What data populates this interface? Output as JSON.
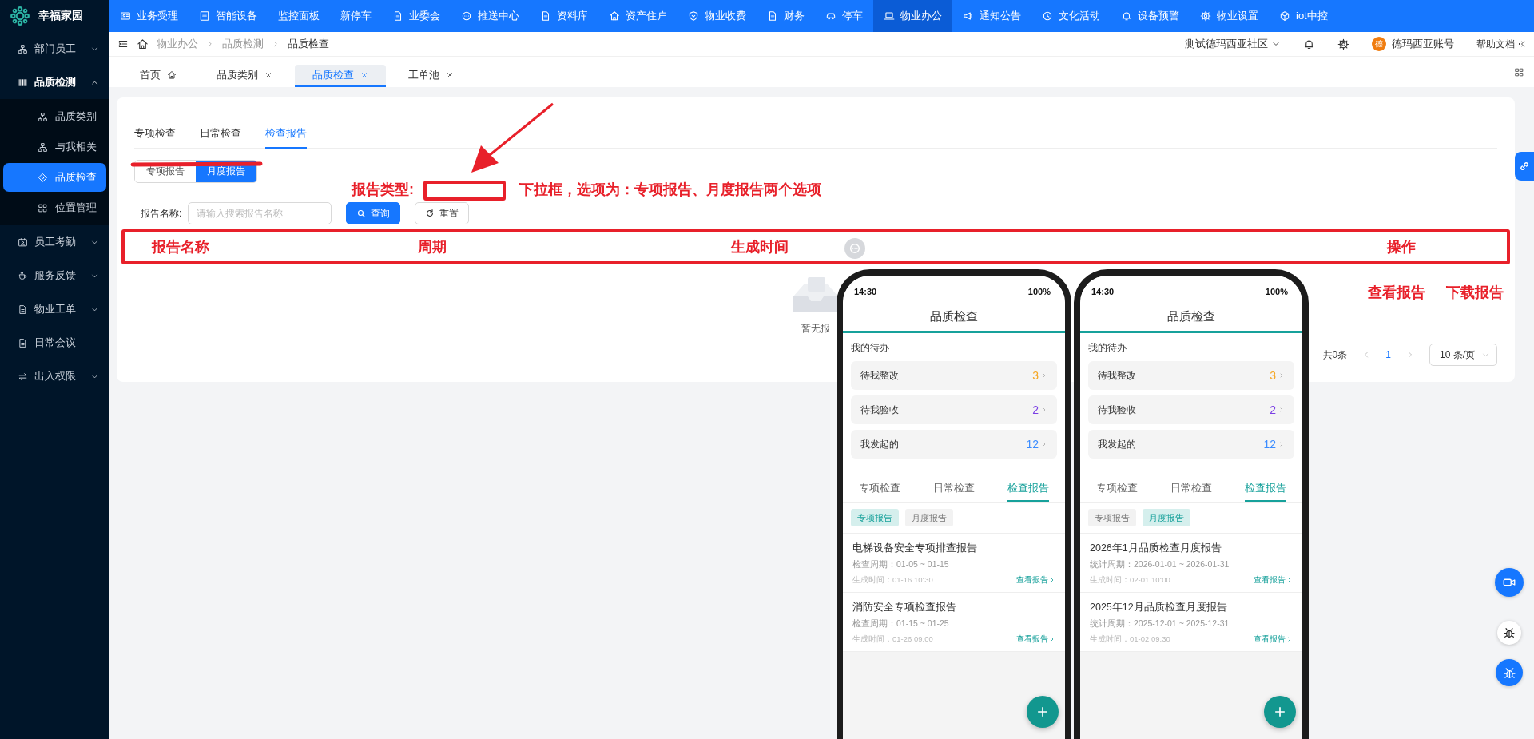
{
  "app": {
    "logo": "幸福家园"
  },
  "top_nav": [
    {
      "label": "业务受理",
      "selected": false
    },
    {
      "label": "智能设备",
      "selected": false
    },
    {
      "label": "监控面板",
      "selected": false
    },
    {
      "label": "新停车",
      "selected": false
    },
    {
      "label": "业委会",
      "selected": false
    },
    {
      "label": "推送中心",
      "selected": false
    },
    {
      "label": "资料库",
      "selected": false
    },
    {
      "label": "资产住户",
      "selected": false
    },
    {
      "label": "物业收费",
      "selected": false
    },
    {
      "label": "财务",
      "selected": false
    },
    {
      "label": "停车",
      "selected": false
    },
    {
      "label": "物业办公",
      "selected": true
    },
    {
      "label": "通知公告",
      "selected": false
    },
    {
      "label": "文化活动",
      "selected": false
    },
    {
      "label": "设备预警",
      "selected": false
    },
    {
      "label": "物业设置",
      "selected": false
    },
    {
      "label": "iot中控",
      "selected": false
    }
  ],
  "sidebar": [
    {
      "label": "部门员工",
      "kind": "group",
      "expanded": false
    },
    {
      "label": "品质检测",
      "kind": "group",
      "expanded": true,
      "children": [
        {
          "label": "品质类别",
          "selected": false
        },
        {
          "label": "与我相关",
          "selected": false
        },
        {
          "label": "品质检查",
          "selected": true
        },
        {
          "label": "位置管理",
          "selected": false
        }
      ]
    },
    {
      "label": "员工考勤",
      "kind": "group",
      "expanded": false
    },
    {
      "label": "服务反馈",
      "kind": "group",
      "expanded": false
    },
    {
      "label": "物业工单",
      "kind": "group",
      "expanded": false
    },
    {
      "label": "日常会议",
      "kind": "link"
    },
    {
      "label": "出入权限",
      "kind": "group",
      "expanded": false
    }
  ],
  "breadcrumb": [
    "物业办公",
    "品质检测",
    "品质检查"
  ],
  "header": {
    "community": "测试德玛西亚社区",
    "avatar": "德",
    "account": "德玛西亚账号",
    "help": "帮助文档"
  },
  "page_tabs": [
    {
      "label": "首页",
      "selected": false,
      "kind": "home"
    },
    {
      "label": "品质类别",
      "selected": false,
      "kind": "closable"
    },
    {
      "label": "品质检查",
      "selected": true,
      "kind": "closable"
    },
    {
      "label": "工单池",
      "selected": false,
      "kind": "closable"
    }
  ],
  "card": {
    "tabs": [
      {
        "label": "专项检查",
        "selected": false
      },
      {
        "label": "日常检查",
        "selected": false
      },
      {
        "label": "检查报告",
        "selected": true
      }
    ],
    "report_types": [
      {
        "label": "专项报告",
        "selected": false
      },
      {
        "label": "月度报告",
        "selected": true
      }
    ],
    "search": {
      "label": "报告名称:",
      "placeholder": "请输入搜索报告名称"
    },
    "buttons": [
      {
        "label": "查询",
        "kind": "primary"
      },
      {
        "label": "重置",
        "kind": "reset"
      }
    ],
    "empty_text": "暂无报",
    "pagination": {
      "total": "共0条",
      "page": "1",
      "page_size": "10 条/页"
    }
  },
  "annotations": {
    "columns": [
      "报告名称",
      "周期",
      "生成时间",
      "操作"
    ],
    "field_label": "报告类型:",
    "note": "下拉框，选项为：专项报告、月度报告两个选项",
    "actions": [
      "查看报告",
      "下载报告"
    ]
  },
  "phones": [
    {
      "time": "14:30",
      "battery": "100%",
      "title": "品质检查",
      "todo_title": "我的待办",
      "todos": [
        {
          "label": "待我整改",
          "count": "3",
          "color": "#f5a623"
        },
        {
          "label": "待我验收",
          "count": "2",
          "color": "#7b3fe4"
        },
        {
          "label": "我发起的",
          "count": "12",
          "color": "#3b8cff"
        }
      ],
      "tabs": [
        {
          "label": "专项检查",
          "selected": false
        },
        {
          "label": "日常检查",
          "selected": false
        },
        {
          "label": "检查报告",
          "selected": true
        }
      ],
      "chips": [
        {
          "label": "专项报告",
          "selected": true
        },
        {
          "label": "月度报告",
          "selected": false
        }
      ],
      "reports": [
        {
          "title": "电梯设备安全专项排查报告",
          "period": "检查周期：01-05 ~ 01-15",
          "created": "生成时间：01-16 10:30",
          "link": "查看报告"
        },
        {
          "title": "消防安全专项检查报告",
          "period": "检查周期：01-15 ~ 01-25",
          "created": "生成时间：01-26 09:00",
          "link": "查看报告"
        }
      ]
    },
    {
      "time": "14:30",
      "battery": "100%",
      "title": "品质检查",
      "todo_title": "我的待办",
      "todos": [
        {
          "label": "待我整改",
          "count": "3",
          "color": "#f5a623"
        },
        {
          "label": "待我验收",
          "count": "2",
          "color": "#7b3fe4"
        },
        {
          "label": "我发起的",
          "count": "12",
          "color": "#3b8cff"
        }
      ],
      "tabs": [
        {
          "label": "专项检查",
          "selected": false
        },
        {
          "label": "日常检查",
          "selected": false
        },
        {
          "label": "检查报告",
          "selected": true
        }
      ],
      "chips": [
        {
          "label": "专项报告",
          "selected": false
        },
        {
          "label": "月度报告",
          "selected": true
        }
      ],
      "reports": [
        {
          "title": "2026年1月品质检查月度报告",
          "period": "统计周期：2026-01-01 ~ 2026-01-31",
          "created": "生成时间：02-01 10:00",
          "link": "查看报告"
        },
        {
          "title": "2025年12月品质检查月度报告",
          "period": "统计周期：2025-12-01 ~ 2025-12-31",
          "created": "生成时间：01-02 09:30",
          "link": "查看报告"
        }
      ]
    }
  ]
}
